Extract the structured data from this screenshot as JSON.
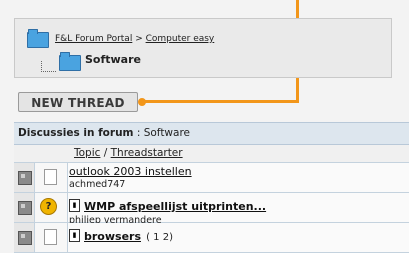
{
  "breadcrumb": {
    "portal_link": "F&L Forum Portal",
    "separator": " > ",
    "category_link": "Computer easy",
    "current": "Software"
  },
  "new_thread_label": "NEW THREAD",
  "forum": {
    "header_prefix": "Discussies in forum",
    "header_sep": " : ",
    "header_name": "Software",
    "col_topic": "Topic",
    "col_sep": " / ",
    "col_starter": "Threadstarter",
    "threads": [
      {
        "title": "outlook 2003 instellen",
        "starter": "achmed747"
      },
      {
        "title": "WMP afspeellijst uitprinten...",
        "starter": "philiep vermandere"
      },
      {
        "title": "browsers",
        "pages": "( 1 2)"
      }
    ]
  },
  "colors": {
    "accent": "#f2961a",
    "header_bg": "#dde6ee"
  }
}
